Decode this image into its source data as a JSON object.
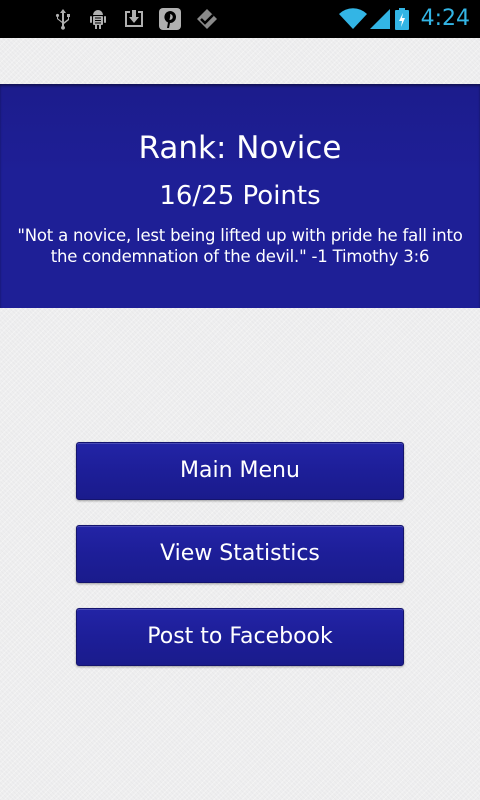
{
  "status_bar": {
    "time": "4:24",
    "left_icons": [
      "usb-icon",
      "android-debug-icon",
      "download-icon",
      "pinterest-icon",
      "app-notification-icon"
    ],
    "right_icons": [
      "wifi-icon",
      "signal-icon",
      "battery-charging-icon"
    ]
  },
  "rank": {
    "title": "Rank: Novice",
    "points": "16/25 Points",
    "quote_line1": "\"Not a novice, lest being lifted up with pride he fall into",
    "quote_line2": "the condemnation of the devil.\" -1 Timothy 3:6"
  },
  "buttons": {
    "main_menu": "Main Menu",
    "view_statistics": "View Statistics",
    "post_facebook": "Post to Facebook"
  },
  "colors": {
    "accent_blue": "#1e1f96",
    "status_time": "#33b5e5",
    "background": "#eeeeef"
  }
}
